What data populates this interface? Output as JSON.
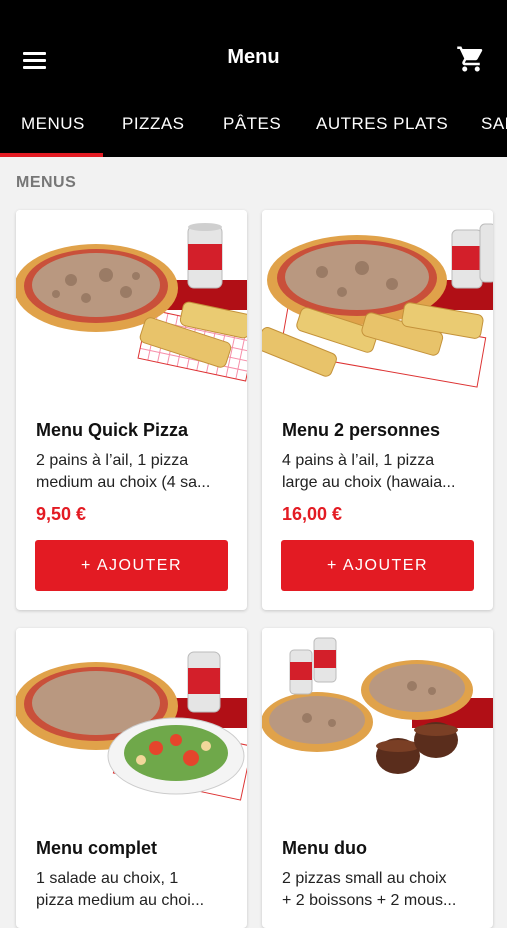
{
  "header": {
    "title": "Menu"
  },
  "tabs": [
    {
      "label": "MENUS"
    },
    {
      "label": "PIZZAS"
    },
    {
      "label": "PÂTES"
    },
    {
      "label": "AUTRES PLATS"
    },
    {
      "label": "SAL"
    }
  ],
  "section": {
    "title": "MENUS"
  },
  "products": [
    {
      "name": "Menu Quick Pizza",
      "desc": "2 pains à l’ail, 1 pizza\nmedium au choix (4 sa...",
      "price": "9,50 €",
      "button": "+ AJOUTER"
    },
    {
      "name": "Menu 2 personnes",
      "desc": "4 pains à l’ail, 1 pizza\nlarge au choix (hawaia...",
      "price": "16,00 €",
      "button": "+ AJOUTER"
    },
    {
      "name": "Menu complet",
      "desc": "1 salade au choix, 1\npizza medium au choi...",
      "price": "",
      "button": ""
    },
    {
      "name": "Menu duo",
      "desc": "2 pizzas small au choix\n+ 2 boissons + 2 mous...",
      "price": "",
      "button": ""
    }
  ],
  "colors": {
    "accent": "#e31b23",
    "bar": "#000000",
    "background": "#f2f2f2"
  }
}
